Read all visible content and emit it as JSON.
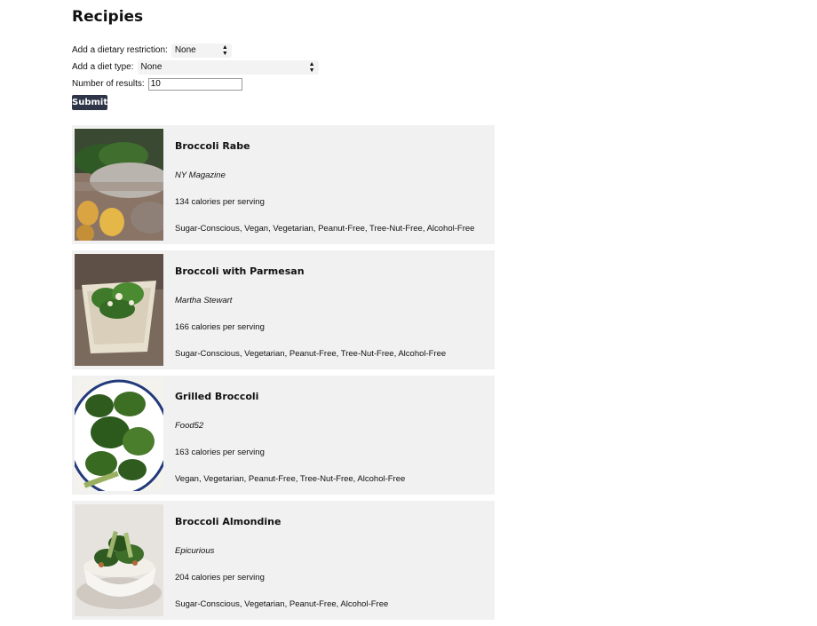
{
  "page": {
    "title": "Recipies"
  },
  "form": {
    "restriction_label": "Add a dietary restriction:",
    "restriction_value": "None",
    "diet_label": "Add a diet type:",
    "diet_value": "None",
    "results_label": "Number of results:",
    "results_value": "10",
    "submit_label": "Submit"
  },
  "recipes": [
    {
      "name": "Broccoli Rabe",
      "source": "NY Magazine",
      "calories": "134 calories per serving",
      "labels": "Sugar-Conscious, Vegan, Vegetarian, Peanut-Free, Tree-Nut-Free, Alcohol-Free",
      "image": "broccoli-rabe-photo"
    },
    {
      "name": "Broccoli with Parmesan",
      "source": "Martha Stewart",
      "calories": "166 calories per serving",
      "labels": "Sugar-Conscious, Vegetarian, Peanut-Free, Tree-Nut-Free, Alcohol-Free",
      "image": "broccoli-parmesan-photo"
    },
    {
      "name": "Grilled Broccoli",
      "source": "Food52",
      "calories": "163 calories per serving",
      "labels": "Vegan, Vegetarian, Peanut-Free, Tree-Nut-Free, Alcohol-Free",
      "image": "grilled-broccoli-photo"
    },
    {
      "name": "Broccoli Almondine",
      "source": "Epicurious",
      "calories": "204 calories per serving",
      "labels": "Sugar-Conscious, Vegetarian, Peanut-Free, Alcohol-Free",
      "image": "broccoli-almondine-photo"
    }
  ]
}
